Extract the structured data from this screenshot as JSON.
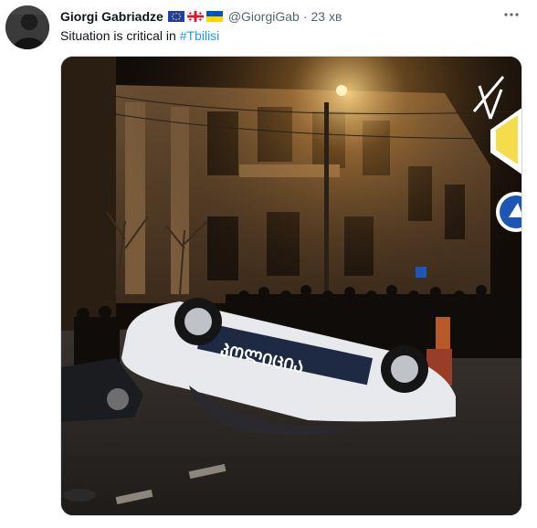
{
  "tweet": {
    "display_name": "Giorgi Gabriadze",
    "flags": [
      "eu-flag-icon",
      "georgia-flag-icon",
      "ukraine-flag-icon"
    ],
    "handle": "@GiorgiGab",
    "separator": "·",
    "time": "23 хв",
    "text": "Situation is critical in ",
    "hashtag": "#Tbilisi",
    "more_icon": "more-horizontal-icon"
  },
  "media": {
    "police_car_text": "პᲝᲚᲘᲪᲘᲐ"
  },
  "colors": {
    "link": "#1d9bf0",
    "secondary_text": "#536471",
    "primary_text": "#0f1419"
  }
}
